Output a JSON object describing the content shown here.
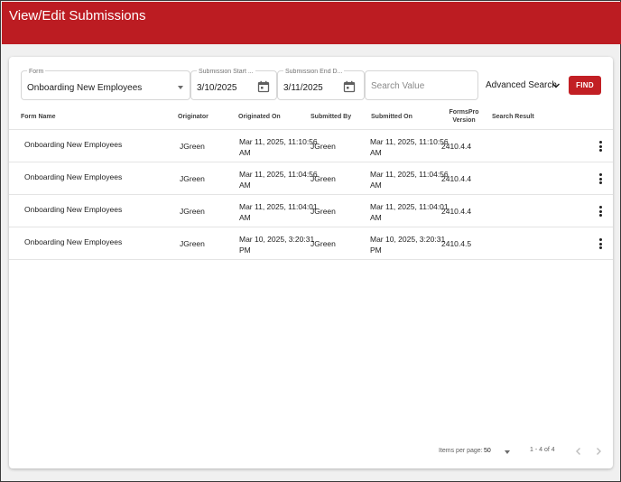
{
  "header": {
    "title": "View/Edit Submissions"
  },
  "filters": {
    "form": {
      "label": "Form",
      "value": "Onboarding New Employees"
    },
    "start_date": {
      "label": "Submission Start ...",
      "value": "3/10/2025"
    },
    "end_date": {
      "label": "Submission End D...",
      "value": "3/11/2025"
    },
    "search": {
      "placeholder": "Search Value",
      "value": ""
    },
    "advanced_search_label": "Advanced Search",
    "find_label": "FIND"
  },
  "table": {
    "columns": {
      "form_name": "Form Name",
      "originator": "Originator",
      "originated_on": "Originated On",
      "submitted_by": "Submitted By",
      "submitted_on": "Submitted On",
      "version_line1": "FormsPro",
      "version_line2": "Version",
      "search_result": "Search Result"
    },
    "rows": [
      {
        "form_name": "Onboarding New Employees",
        "originator": "JGreen",
        "originated_on_1": "Mar 11, 2025, 11:10:56",
        "originated_on_2": "AM",
        "submitted_by": "JGreen",
        "submitted_on_1": "Mar 11, 2025, 11:10:56",
        "submitted_on_2": "AM",
        "version": "2410.4.4"
      },
      {
        "form_name": "Onboarding New Employees",
        "originator": "JGreen",
        "originated_on_1": "Mar 11, 2025, 11:04:56",
        "originated_on_2": "AM",
        "submitted_by": "JGreen",
        "submitted_on_1": "Mar 11, 2025, 11:04:56",
        "submitted_on_2": "AM",
        "version": "2410.4.4"
      },
      {
        "form_name": "Onboarding New Employees",
        "originator": "JGreen",
        "originated_on_1": "Mar 11, 2025, 11:04:01",
        "originated_on_2": "AM",
        "submitted_by": "JGreen",
        "submitted_on_1": "Mar 11, 2025, 11:04:01",
        "submitted_on_2": "AM",
        "version": "2410.4.4"
      },
      {
        "form_name": "Onboarding New Employees",
        "originator": "JGreen",
        "originated_on_1": "Mar 10, 2025, 3:20:31",
        "originated_on_2": "PM",
        "submitted_by": "JGreen",
        "submitted_on_1": "Mar 10, 2025, 3:20:31",
        "submitted_on_2": "PM",
        "version": "2410.4.5"
      }
    ]
  },
  "pagination": {
    "items_per_page_label": "Items per page:",
    "items_per_page_value": "50",
    "range_label": "1 - 4 of 4"
  },
  "colors": {
    "brand_red": "#bc1c22",
    "find_button": "#c21f24"
  }
}
